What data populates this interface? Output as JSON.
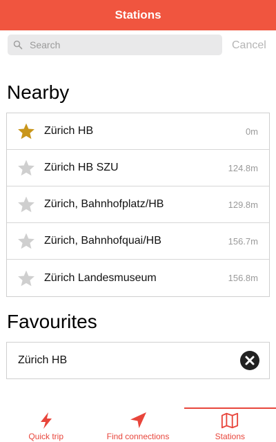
{
  "header": {
    "title": "Stations"
  },
  "search": {
    "placeholder": "Search",
    "value": "",
    "cancel_label": "Cancel"
  },
  "nearby": {
    "title": "Nearby",
    "items": [
      {
        "name": "Zürich HB",
        "distance": "0m",
        "favourite": true
      },
      {
        "name": "Zürich HB SZU",
        "distance": "124.8m",
        "favourite": false
      },
      {
        "name": "Zürich, Bahnhofplatz/HB",
        "distance": "129.8m",
        "favourite": false
      },
      {
        "name": "Zürich, Bahnhofquai/HB",
        "distance": "156.7m",
        "favourite": false
      },
      {
        "name": "Zürich Landesmuseum",
        "distance": "156.8m",
        "favourite": false
      }
    ]
  },
  "favourites": {
    "title": "Favourites",
    "items": [
      {
        "name": "Zürich HB"
      }
    ]
  },
  "tabs": [
    {
      "label": "Quick trip",
      "icon": "lightning-icon",
      "active": false
    },
    {
      "label": "Find connections",
      "icon": "location-arrow-icon",
      "active": false
    },
    {
      "label": "Stations",
      "icon": "map-icon",
      "active": true
    }
  ],
  "colors": {
    "header": "#f0553f",
    "accent": "#e8453b",
    "star_active": "#c9961b",
    "star_inactive": "#cfcfcf"
  }
}
